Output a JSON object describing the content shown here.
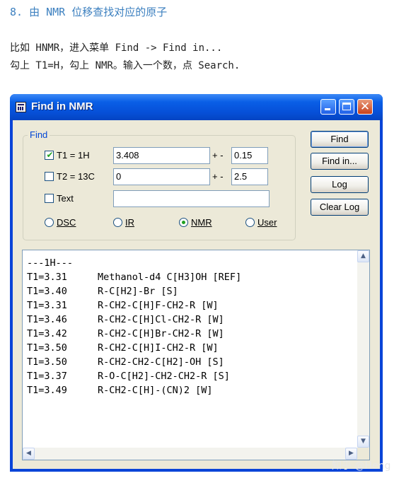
{
  "article": {
    "heading": "8. 由 NMR 位移查找对应的原子",
    "line1": "比如 HNMR，进入菜单 Find -> Find in...",
    "line2": "勾上 T1=H，勾上 NMR。输入一个数，点 Search."
  },
  "window": {
    "title": "Find in NMR",
    "close_glyph": "✕"
  },
  "find_group": {
    "legend": "Find",
    "t1": {
      "label": "T1 = 1H",
      "checked": true,
      "value": "3.408",
      "pm": "+ -",
      "tolerance": "0.15"
    },
    "t2": {
      "label": "T2 = 13C",
      "checked": false,
      "value": "0",
      "pm": "+ -",
      "tolerance": "2.5"
    },
    "text": {
      "label": "Text",
      "checked": false,
      "value": ""
    },
    "check_glyph": "✔",
    "radios": [
      {
        "label": "DSC",
        "selected": false
      },
      {
        "label": "IR",
        "selected": false
      },
      {
        "label": "NMR",
        "selected": true
      },
      {
        "label": "User",
        "selected": false
      }
    ]
  },
  "buttons": {
    "find": "Find",
    "find_in": "Find in...",
    "log": "Log",
    "clear_log": "Clear Log"
  },
  "output": {
    "header": "---1H---",
    "rows": [
      {
        "t": "T1=3.31",
        "desc": "Methanol-d4 C[H3]OH [REF]"
      },
      {
        "t": "T1=3.40",
        "desc": "R-C[H2]-Br [S]"
      },
      {
        "t": "T1=3.31",
        "desc": "R-CH2-C[H]F-CH2-R [W]"
      },
      {
        "t": "T1=3.46",
        "desc": "R-CH2-C[H]Cl-CH2-R [W]"
      },
      {
        "t": "T1=3.42",
        "desc": "R-CH2-C[H]Br-CH2-R [W]"
      },
      {
        "t": "T1=3.50",
        "desc": "R-CH2-C[H]I-CH2-R [W]"
      },
      {
        "t": "T1=3.50",
        "desc": "R-CH2-CH2-C[H2]-OH [S]"
      },
      {
        "t": "T1=3.37",
        "desc": "R-O-C[H2]-CH2-CH2-R [S]"
      },
      {
        "t": "T1=3.49",
        "desc": "R-CH2-C[H]-(CN)2 [W]"
      }
    ],
    "scroll_up": "▲",
    "scroll_down": "▼",
    "scroll_left": "◀",
    "scroll_right": "▶"
  },
  "watermark": "知乎 @Heng",
  "colors": {
    "heading": "#3b7fbf",
    "titlebar": "#0a5fe6",
    "dialog_bg": "#ece9d8",
    "check_green": "#21a121"
  }
}
